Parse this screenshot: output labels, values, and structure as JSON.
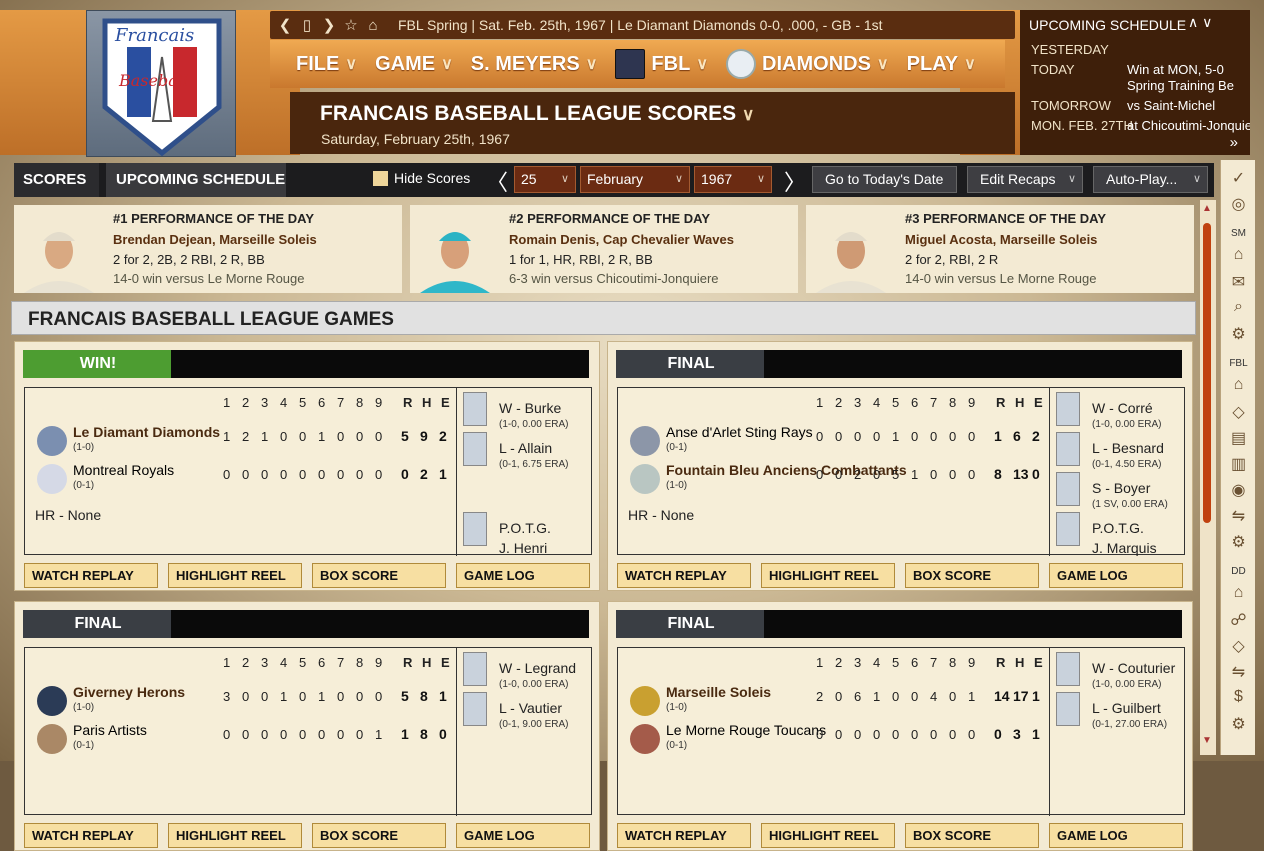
{
  "infobar": {
    "text": "FBL Spring  |  Sat. Feb. 25th, 1967  |  Le Diamant Diamonds   0-0, .000, - GB - 1st"
  },
  "logo": {
    "line1": "Francais",
    "line2": "Baseball"
  },
  "menu": [
    {
      "label": "FILE"
    },
    {
      "label": "GAME"
    },
    {
      "label": "S. MEYERS"
    },
    {
      "label": "FBL"
    },
    {
      "label": "DIAMONDS"
    },
    {
      "label": "PLAY"
    }
  ],
  "page": {
    "title": "FRANCAIS BASEBALL LEAGUE SCORES",
    "date": "Saturday, February 25th, 1967"
  },
  "schedule": {
    "title": "UPCOMING SCHEDULE",
    "rows": [
      {
        "day": "YESTERDAY",
        "val": ""
      },
      {
        "day": "TODAY",
        "val": "Win at MON, 5-0"
      },
      {
        "day": "",
        "val": "Spring Training Be"
      },
      {
        "day": "TOMORROW",
        "val": "vs Saint-Michel"
      },
      {
        "day": "MON. FEB. 27TH",
        "val": "at Chicoutimi-Jonquie"
      }
    ]
  },
  "tabs": {
    "scores": "SCORES",
    "upcoming": "UPCOMING SCHEDULE"
  },
  "controls": {
    "hide_scores": "Hide Scores",
    "day": "25",
    "month": "February",
    "year": "1967",
    "today_btn": "Go to Today's Date",
    "recaps_btn": "Edit Recaps",
    "autoplay_btn": "Auto-Play..."
  },
  "sidebar": {
    "sm": "SM",
    "fbl": "FBL",
    "dd": "DD"
  },
  "performances": [
    {
      "title": "#1 PERFORMANCE OF THE DAY",
      "name": "Brendan Dejean, Marseille Soleis",
      "line": "2 for 2, 2B, 2 RBI, 2 R, BB",
      "result": "14-0 win versus Le Morne Rouge"
    },
    {
      "title": "#2 PERFORMANCE OF THE DAY",
      "name": "Romain Denis, Cap Chevalier Waves",
      "line": "1 for 1, HR, RBI, 2 R, BB",
      "result": "6-3 win versus Chicoutimi-Jonquiere"
    },
    {
      "title": "#3 PERFORMANCE OF THE DAY",
      "name": "Miguel Acosta, Marseille Soleis",
      "line": "2 for 2, RBI, 2 R",
      "result": "14-0 win versus Le Morne Rouge"
    }
  ],
  "section": {
    "title": "FRANCAIS BASEBALL LEAGUE GAMES"
  },
  "innings_header": [
    "1",
    "2",
    "3",
    "4",
    "5",
    "6",
    "7",
    "8",
    "9"
  ],
  "rhe_header": [
    "R",
    "H",
    "E"
  ],
  "buttons": {
    "replay": "WATCH REPLAY",
    "reel": "HIGHLIGHT REEL",
    "box": "BOX SCORE",
    "log": "GAME LOG"
  },
  "games": [
    {
      "status": "WIN!",
      "teams": [
        {
          "name": "Le Diamant Diamonds",
          "record": "(1-0)",
          "innings": [
            "1",
            "2",
            "1",
            "0",
            "0",
            "1",
            "0",
            "0",
            "0"
          ],
          "r": "5",
          "h": "9",
          "e": "2",
          "bold": true
        },
        {
          "name": "Montreal Royals",
          "record": "(0-1)",
          "innings": [
            "0",
            "0",
            "0",
            "0",
            "0",
            "0",
            "0",
            "0",
            "0"
          ],
          "r": "0",
          "h": "2",
          "e": "1",
          "bold": false
        }
      ],
      "hr": "HR - None",
      "pitchers": [
        {
          "label": "W - Burke",
          "stat": "(1-0, 0.00 ERA)"
        },
        {
          "label": "L - Allain",
          "stat": "(0-1, 6.75 ERA)"
        },
        {
          "label": "P.O.T.G.",
          "stat": "J. Henri"
        }
      ]
    },
    {
      "status": "FINAL",
      "teams": [
        {
          "name": "Anse d'Arlet Sting Rays",
          "record": "(0-1)",
          "innings": [
            "0",
            "0",
            "0",
            "0",
            "1",
            "0",
            "0",
            "0",
            "0"
          ],
          "r": "1",
          "h": "6",
          "e": "2",
          "bold": false
        },
        {
          "name": "Fountain Bleu Anciens Combattants",
          "record": "(1-0)",
          "innings": [
            "0",
            "0",
            "2",
            "0",
            "5",
            "1",
            "0",
            "0",
            "0"
          ],
          "r": "8",
          "h": "13",
          "e": "0",
          "bold": true
        }
      ],
      "hr": "HR - None",
      "pitchers": [
        {
          "label": "W - Corré",
          "stat": "(1-0, 0.00 ERA)"
        },
        {
          "label": "L - Besnard",
          "stat": "(0-1, 4.50 ERA)"
        },
        {
          "label": "S - Boyer",
          "stat": "(1 SV, 0.00 ERA)"
        },
        {
          "label": "P.O.T.G.",
          "stat": "J. Marquis"
        }
      ]
    },
    {
      "status": "FINAL",
      "teams": [
        {
          "name": "Giverney Herons",
          "record": "(1-0)",
          "innings": [
            "3",
            "0",
            "0",
            "1",
            "0",
            "1",
            "0",
            "0",
            "0"
          ],
          "r": "5",
          "h": "8",
          "e": "1",
          "bold": true
        },
        {
          "name": "Paris Artists",
          "record": "(0-1)",
          "innings": [
            "0",
            "0",
            "0",
            "0",
            "0",
            "0",
            "0",
            "0",
            "1"
          ],
          "r": "1",
          "h": "8",
          "e": "0",
          "bold": false
        }
      ],
      "hr": "",
      "pitchers": [
        {
          "label": "W - Legrand",
          "stat": "(1-0, 0.00 ERA)"
        },
        {
          "label": "L - Vautier",
          "stat": "(0-1, 9.00 ERA)"
        }
      ]
    },
    {
      "status": "FINAL",
      "teams": [
        {
          "name": "Marseille Soleis",
          "record": "(1-0)",
          "innings": [
            "2",
            "0",
            "6",
            "1",
            "0",
            "0",
            "4",
            "0",
            "1"
          ],
          "r": "14",
          "h": "17",
          "e": "1",
          "bold": true
        },
        {
          "name": "Le Morne Rouge Toucans",
          "record": "(0-1)",
          "innings": [
            "0",
            "0",
            "0",
            "0",
            "0",
            "0",
            "0",
            "0",
            "0"
          ],
          "r": "0",
          "h": "3",
          "e": "1",
          "bold": false
        }
      ],
      "hr": "",
      "pitchers": [
        {
          "label": "W - Couturier",
          "stat": "(1-0, 0.00 ERA)"
        },
        {
          "label": "L - Guilbert",
          "stat": "(0-1, 27.00 ERA)"
        }
      ]
    }
  ]
}
